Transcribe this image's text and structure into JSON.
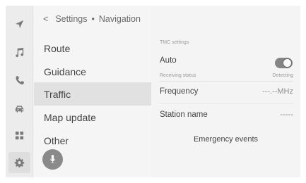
{
  "rail": {
    "icons": [
      "navigation-arrow-icon",
      "music-note-icon",
      "phone-icon",
      "car-icon",
      "apps-grid-icon",
      "settings-gear-icon"
    ],
    "active": "settings-gear-icon"
  },
  "menu": {
    "breadcrumb": {
      "back_glyph": "<",
      "parent": "Settings",
      "separator": "•",
      "current": "Navigation"
    },
    "items": [
      {
        "label": "Route",
        "selected": false
      },
      {
        "label": "Guidance",
        "selected": false
      },
      {
        "label": "Traffic",
        "selected": true
      },
      {
        "label": "Map update",
        "selected": false
      },
      {
        "label": "Other",
        "selected": false
      }
    ],
    "voice_button_icon": "microphone-icon"
  },
  "panel": {
    "section_title": "TMC settings",
    "auto": {
      "label": "Auto",
      "enabled": true
    },
    "receiving_status": {
      "label": "Receiving status",
      "value": "Detecting"
    },
    "frequency": {
      "label": "Frequency",
      "value": "---.--MHz"
    },
    "station_name": {
      "label": "Station name",
      "value": "-----"
    },
    "emergency_button": "Emergency events"
  },
  "colors": {
    "background": "#f3f3f3",
    "selected_row": "#e1e1e1",
    "toggle_on": "#848484",
    "voice_button": "#8a8a8a"
  }
}
